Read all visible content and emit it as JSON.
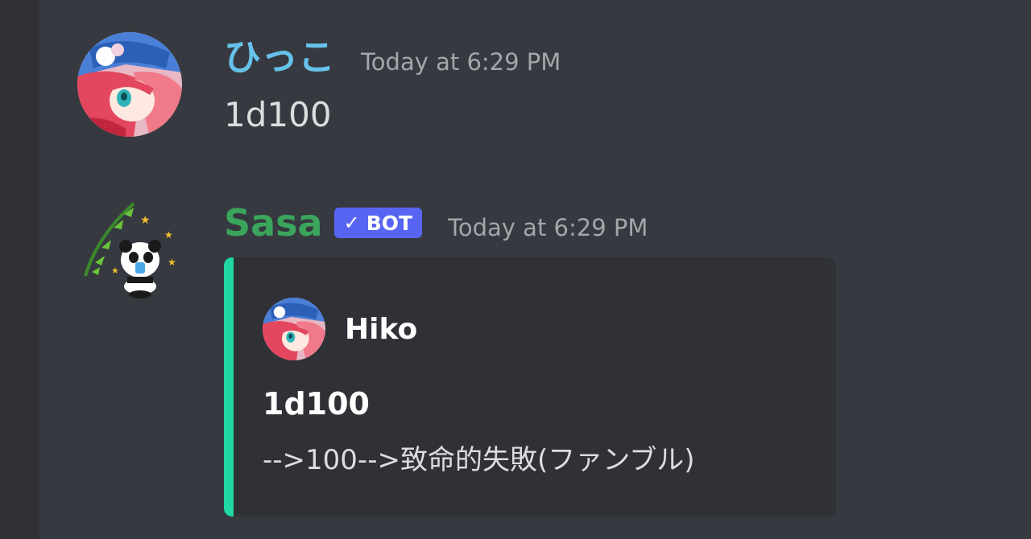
{
  "messages": [
    {
      "username": "ひっこ",
      "timestamp": "Today at 6:29 PM",
      "text": "1d100",
      "avatar_icon": "anime-girl-avatar"
    },
    {
      "username": "Sasa",
      "bot_tag": {
        "check": "✓",
        "label": "BOT"
      },
      "timestamp": "Today at 6:29 PM",
      "avatar_icon": "panda-bamboo-avatar",
      "embed": {
        "accent_color": "#1fd8a4",
        "author_name": "Hiko",
        "title": "1d100",
        "description": "-->100-->致命的失敗(ファンブル)"
      }
    }
  ],
  "colors": {
    "background": "#36393f",
    "user1_name": "#66c2ea",
    "bot_name": "#3ba55c",
    "bot_tag": "#5865f2"
  }
}
